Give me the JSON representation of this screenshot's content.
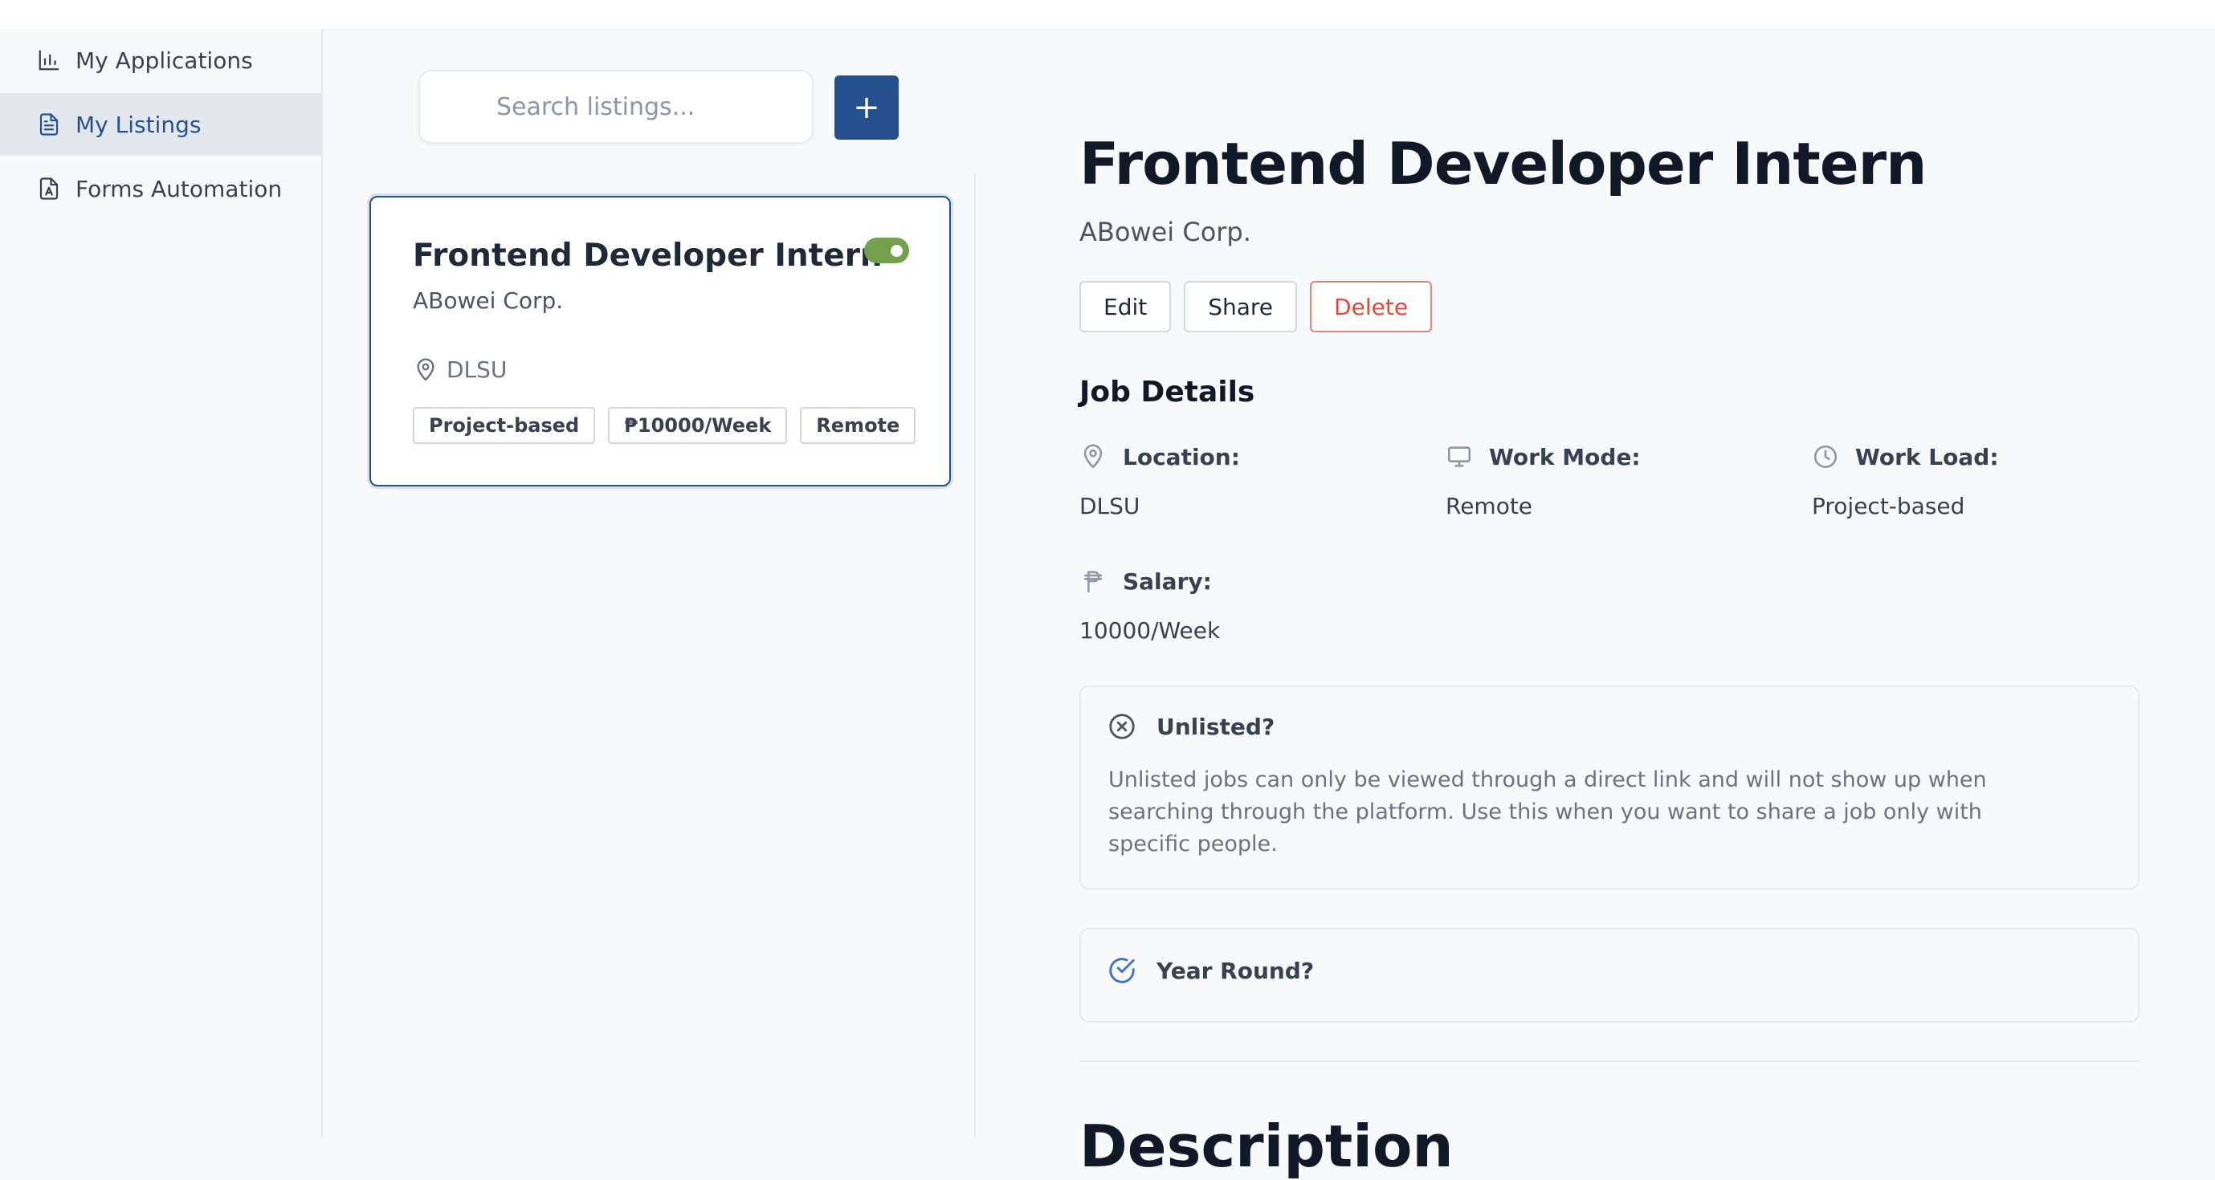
{
  "sidebar": {
    "items": [
      {
        "label": "My Applications",
        "icon": "bar-chart-icon",
        "active": false
      },
      {
        "label": "My Listings",
        "icon": "document-icon",
        "active": true
      },
      {
        "label": "Forms Automation",
        "icon": "form-icon",
        "active": false
      }
    ]
  },
  "listings": {
    "search_placeholder": "Search listings...",
    "add_label": "+",
    "card": {
      "title": "Frontend Developer Intern",
      "company": "ABowei Corp.",
      "location": "DLSU",
      "tags": [
        "Project-based",
        "₱10000/Week",
        "Remote"
      ],
      "listed": true
    }
  },
  "detail": {
    "title": "Frontend Developer Intern",
    "company": "ABowei Corp.",
    "actions": {
      "edit": "Edit",
      "share": "Share",
      "delete": "Delete"
    },
    "section_title": "Job Details",
    "fields": {
      "location": {
        "label": "Location:",
        "value": "DLSU"
      },
      "work_mode": {
        "label": "Work Mode:",
        "value": "Remote"
      },
      "work_load": {
        "label": "Work Load:",
        "value": "Project-based"
      },
      "salary": {
        "label": "Salary:",
        "value": "10000/Week"
      }
    },
    "unlisted": {
      "label": "Unlisted?",
      "text": "Unlisted jobs can only be viewed through a direct link and will not show up when searching through the platform. Use this when you want to share a job only with specific people."
    },
    "year_round": {
      "label": "Year Round?"
    },
    "description_title": "Description"
  },
  "colors": {
    "accent": "#25508f",
    "toggle_on": "#74a04e",
    "danger": "#dc4b3e"
  }
}
